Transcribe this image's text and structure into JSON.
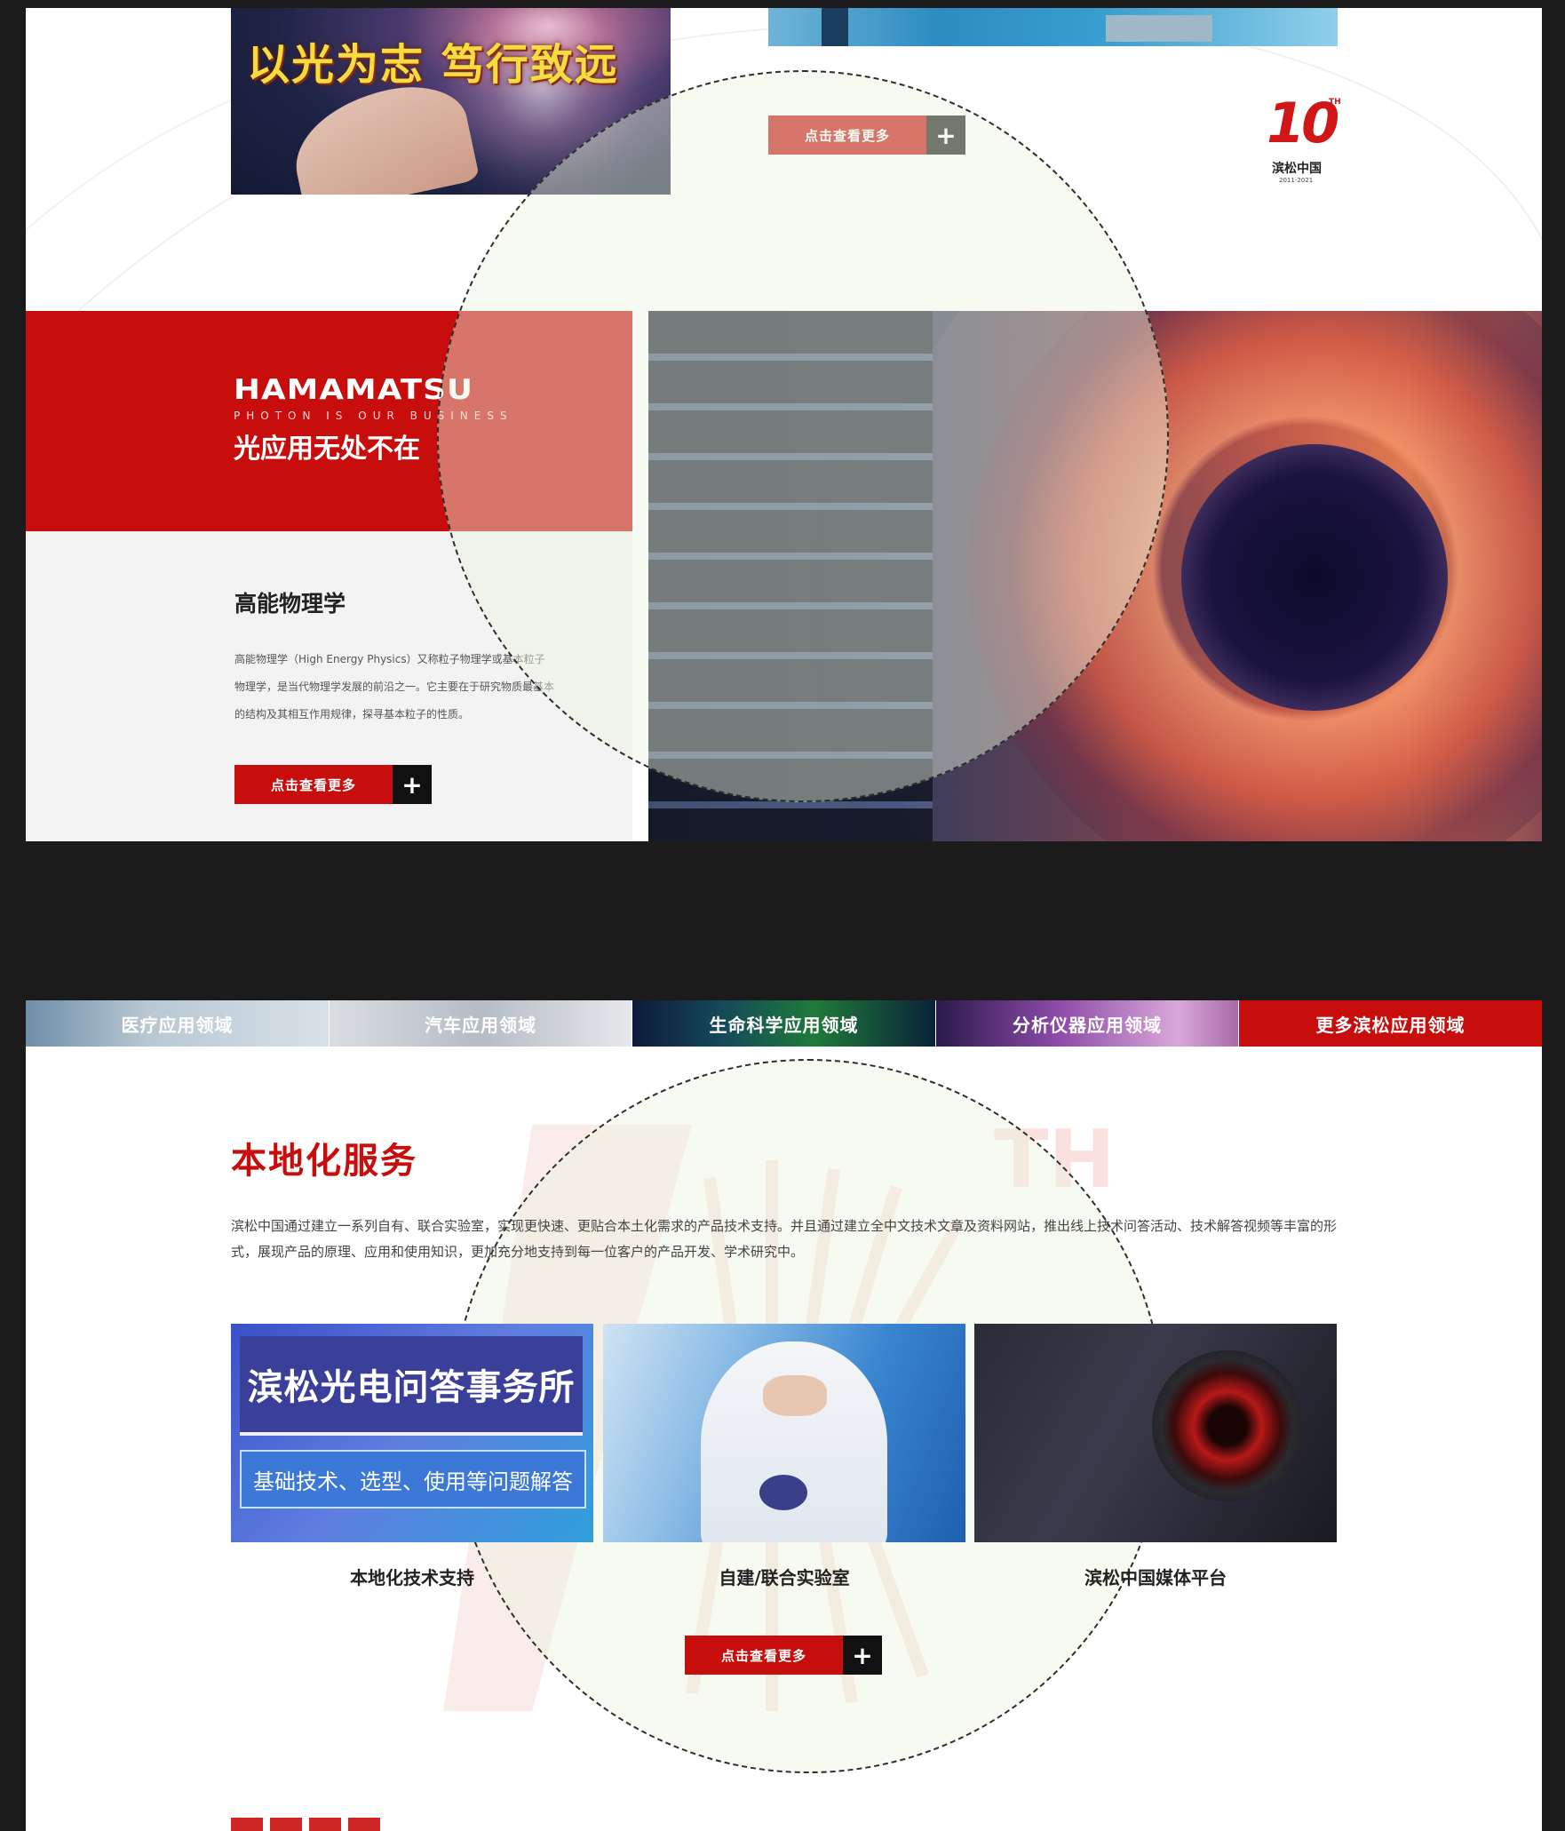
{
  "top": {
    "banner_text": "以光为志 笃行致远",
    "button_label": "点击查看更多",
    "button_plus": "+",
    "anniversary_logo_mark": "10",
    "anniversary_logo_sup": "TH",
    "anniversary_logo_name": "滨松中国",
    "anniversary_logo_years": "2011-2021"
  },
  "hero": {
    "brand": "HAMAMATSU",
    "tagline": "PHOTON IS OUR BUSINESS",
    "slogan": "光应用无处不在",
    "section_title": "高能物理学",
    "description": "高能物理学（High Energy Physics）又称粒子物理学或基本粒子物理学，是当代物理学发展的前沿之一。它主要在于研究物质最基本的结构及其相互作用规律，探寻基本粒子的性质。",
    "button_label": "点击查看更多",
    "button_plus": "+"
  },
  "tabs": [
    {
      "label": "医疗应用领域"
    },
    {
      "label": "汽车应用领域"
    },
    {
      "label": "生命科学应用领域"
    },
    {
      "label": "分析仪器应用领域"
    },
    {
      "label": "更多滨松应用领域"
    }
  ],
  "local": {
    "title": "本地化服务",
    "description": "滨松中国通过建立一系列自有、联合实验室，实现更快速、更贴合本土化需求的产品技术支持。并且通过建立全中文技术文章及资料网站，推出线上技术问答活动、技术解答视频等丰富的形式，展现产品的原理、应用和使用知识，更加充分地支持到每一位客户的产品开发、学术研究中。",
    "cards": [
      {
        "caption": "本地化技术支持",
        "overlay_title": "滨松光电问答事务所",
        "overlay_sub": "基础技术、选型、使用等问题解答"
      },
      {
        "caption": "自建/联合实验室"
      },
      {
        "caption": "滨松中国媒体平台"
      }
    ],
    "watermark_text": "TH",
    "button_label": "点击查看更多",
    "button_plus": "+"
  },
  "colors": {
    "brand_red": "#c80d0d",
    "dark_bg": "#1b1b1c",
    "button_dark": "#111111"
  }
}
